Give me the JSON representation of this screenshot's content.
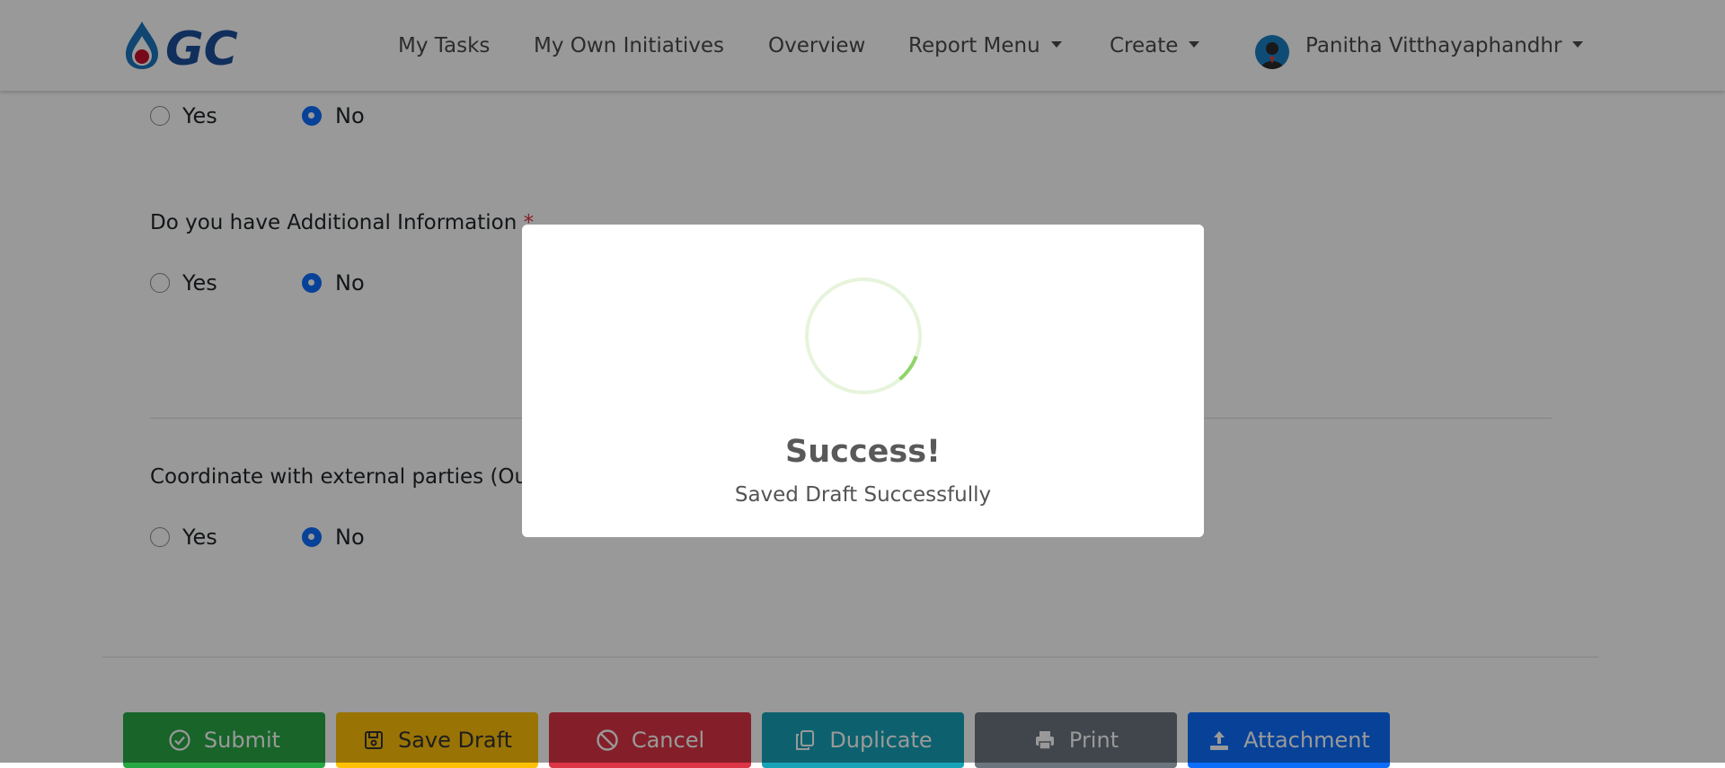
{
  "nav": {
    "items": [
      "My Tasks",
      "My Own Initiatives",
      "Overview",
      "Report Menu",
      "Create"
    ],
    "user_name": "Panitha Vitthayaphandhr"
  },
  "form": {
    "questions": [
      {
        "label": "",
        "required": false,
        "yes_label": "Yes",
        "no_label": "No",
        "selected": "No"
      },
      {
        "label": "Do you have Additional Information",
        "required": true,
        "yes_label": "Yes",
        "no_label": "No",
        "selected": "No"
      },
      {
        "label": "Coordinate with external parties (Ou",
        "required": false,
        "yes_label": "Yes",
        "no_label": "No",
        "selected": "No"
      }
    ],
    "required_mark": "*"
  },
  "buttons": {
    "submit": "Submit",
    "save_draft": "Save Draft",
    "cancel": "Cancel",
    "duplicate": "Duplicate",
    "print": "Print",
    "attachment": "Attachment"
  },
  "modal": {
    "title": "Success!",
    "message": "Saved Draft Successfully",
    "spinner_progress": 0.08
  },
  "colors": {
    "primary": "#0d6efd",
    "success": "#28a745",
    "warning": "#ffc107",
    "danger": "#dc3545",
    "info": "#17a2b8",
    "secondary": "#6c757d",
    "spinner_ring": "#e6f4dc",
    "spinner_arc": "#8fd46a"
  },
  "icons": {
    "logo": "gc-logo",
    "submit": "check-circle-icon",
    "save_draft": "floppy-disk-icon",
    "cancel": "ban-icon",
    "duplicate": "copy-icon",
    "print": "printer-icon",
    "attachment": "upload-icon",
    "dropdown": "caret-down-icon"
  }
}
